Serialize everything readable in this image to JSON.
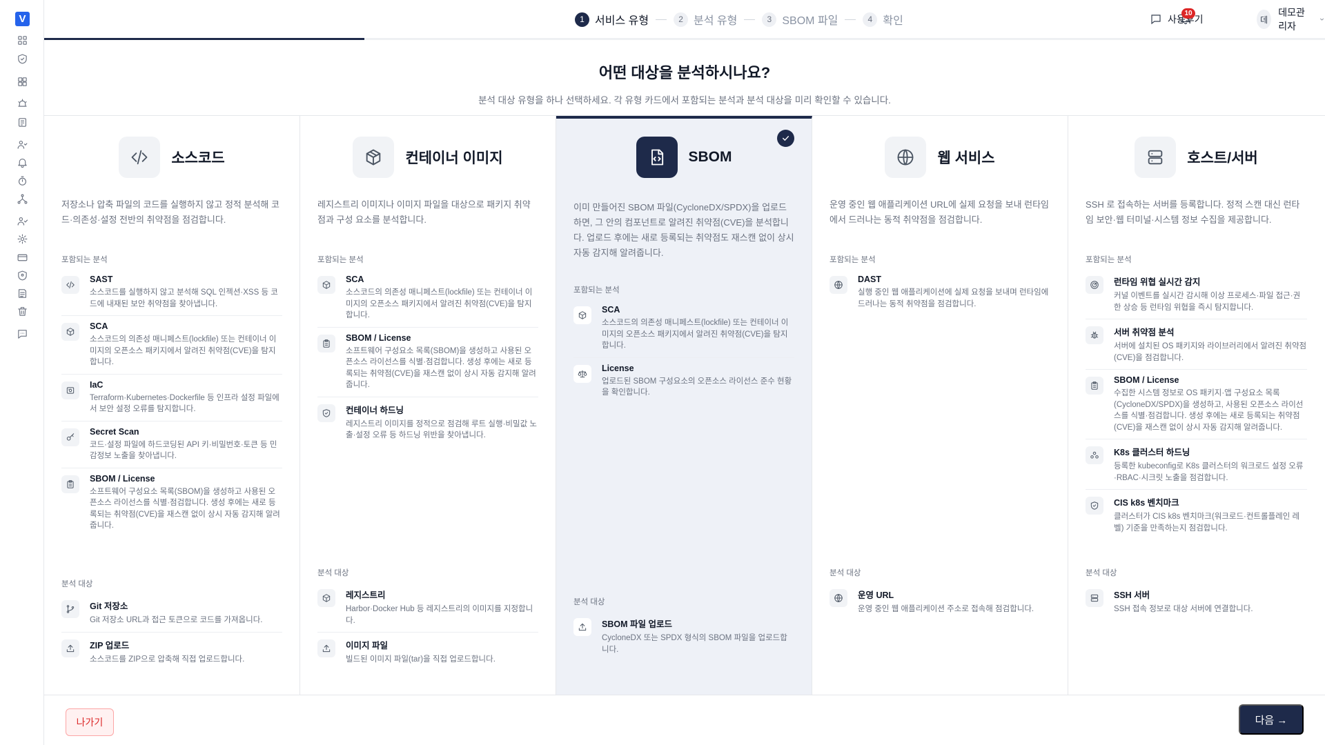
{
  "app": {
    "logo_letter": "V",
    "brand_color": "#2563eb",
    "accent": "#1e2a4a",
    "danger": "#dc2626"
  },
  "rail": [
    "dashboard-icon",
    "shield-check-icon",
    "grid-icon",
    "alarm-icon",
    "report-icon",
    "users-icon",
    "bell-icon",
    "timer-icon",
    "network-icon",
    "user-check-icon",
    "gear-icon",
    "card-icon",
    "shield-icon",
    "ledger-icon",
    "trash-icon",
    "chat-icon"
  ],
  "steps": [
    {
      "num": "1",
      "label": "서비스 유형",
      "active": true
    },
    {
      "num": "2",
      "label": "분석 유형",
      "active": false
    },
    {
      "num": "3",
      "label": "SBOM 파일",
      "active": false
    },
    {
      "num": "4",
      "label": "확인",
      "active": false
    }
  ],
  "progress_fraction": 0.25,
  "header": {
    "review_label": "사용후기",
    "notif_count": "10",
    "avatar_initial": "데",
    "user_name": "데모관리자"
  },
  "heading": {
    "title": "어떤 대상을 분석하시나요?",
    "subtitle": "분석 대상 유형을 하나 선택하세요. 각 유형 카드에서 포함되는 분석과 분석 대상을 미리 확인할 수 있습니다."
  },
  "labels": {
    "included": "포함되는 분석",
    "targets": "분석 대상"
  },
  "cards": [
    {
      "title": "소스코드",
      "icon": "code-icon",
      "selected": false,
      "desc": "저장소나 압축 파일의 코드를 실행하지 않고 정적 분석해 코드·의존성·설정 전반의 취약점을 점검합니다.",
      "analyses": [
        {
          "title": "SAST",
          "icon": "code-icon",
          "desc": "소스코드를 실행하지 않고 분석해 SQL 인젝션·XSS 등 코드에 내재된 보안 취약점을 찾아냅니다."
        },
        {
          "title": "SCA",
          "icon": "package-icon",
          "desc": "소스코드의 의존성 매니페스트(lockfile) 또는 컨테이너 이미지의 오픈소스 패키지에서 알려진 취약점(CVE)을 탐지합니다."
        },
        {
          "title": "IaC",
          "icon": "server-config-icon",
          "desc": "Terraform·Kubernetes·Dockerfile 등 인프라 설정 파일에서 보안 설정 오류를 탐지합니다."
        },
        {
          "title": "Secret Scan",
          "icon": "key-icon",
          "desc": "코드·설정 파일에 하드코딩된 API 키·비밀번호·토큰 등 민감정보 노출을 찾아냅니다."
        },
        {
          "title": "SBOM / License",
          "icon": "clipboard-icon",
          "desc": "소프트웨어 구성요소 목록(SBOM)을 생성하고 사용된 오픈소스 라이선스를 식별·점검합니다. 생성 후에는 새로 등록되는 취약점(CVE)을 재스캔 없이 상시 자동 감지해 알려줍니다."
        }
      ],
      "targets": [
        {
          "title": "Git 저장소",
          "icon": "git-branch-icon",
          "desc": "Git 저장소 URL과 접근 토큰으로 코드를 가져옵니다."
        },
        {
          "title": "ZIP 업로드",
          "icon": "upload-icon",
          "desc": "소스코드를 ZIP으로 압축해 직접 업로드합니다."
        }
      ]
    },
    {
      "title": "컨테이너 이미지",
      "icon": "container-box-icon",
      "selected": false,
      "desc": "레지스트리 이미지나 이미지 파일을 대상으로 패키지 취약점과 구성 요소를 분석합니다.",
      "analyses": [
        {
          "title": "SCA",
          "icon": "package-icon",
          "desc": "소스코드의 의존성 매니페스트(lockfile) 또는 컨테이너 이미지의 오픈소스 패키지에서 알려진 취약점(CVE)을 탐지합니다."
        },
        {
          "title": "SBOM / License",
          "icon": "clipboard-icon",
          "desc": "소프트웨어 구성요소 목록(SBOM)을 생성하고 사용된 오픈소스 라이선스를 식별·점검합니다. 생성 후에는 새로 등록되는 취약점(CVE)을 재스캔 없이 상시 자동 감지해 알려줍니다."
        },
        {
          "title": "컨테이너 하드닝",
          "icon": "shield-check-icon",
          "desc": "레지스트리 이미지를 정적으로 점검해 루트 실행·비밀값 노출·설정 오류 등 하드닝 위반을 찾아냅니다."
        }
      ],
      "targets": [
        {
          "title": "레지스트리",
          "icon": "package-icon",
          "desc": "Harbor·Docker Hub 등 레지스트리의 이미지를 지정합니다."
        },
        {
          "title": "이미지 파일",
          "icon": "upload-icon",
          "desc": "빌드된 이미지 파일(tar)을 직접 업로드합니다."
        }
      ]
    },
    {
      "title": "SBOM",
      "icon": "file-code-icon",
      "selected": true,
      "desc": "이미 만들어진 SBOM 파일(CycloneDX/SPDX)을 업로드하면, 그 안의 컴포넌트로 알려진 취약점(CVE)을 분석합니다. 업로드 후에는 새로 등록되는 취약점도 재스캔 없이 상시 자동 감지해 알려줍니다.",
      "analyses": [
        {
          "title": "SCA",
          "icon": "package-icon",
          "desc": "소스코드의 의존성 매니페스트(lockfile) 또는 컨테이너 이미지의 오픈소스 패키지에서 알려진 취약점(CVE)을 탐지합니다."
        },
        {
          "title": "License",
          "icon": "scale-icon",
          "desc": "업로드된 SBOM 구성요소의 오픈소스 라이선스 준수 현황을 확인합니다."
        }
      ],
      "targets": [
        {
          "title": "SBOM 파일 업로드",
          "icon": "upload-icon",
          "desc": "CycloneDX 또는 SPDX 형식의 SBOM 파일을 업로드합니다."
        }
      ]
    },
    {
      "title": "웹 서비스",
      "icon": "globe-icon",
      "selected": false,
      "desc": "운영 중인 웹 애플리케이션 URL에 실제 요청을 보내 런타임에서 드러나는 동적 취약점을 점검합니다.",
      "analyses": [
        {
          "title": "DAST",
          "icon": "globe-icon",
          "desc": "실행 중인 웹 애플리케이션에 실제 요청을 보내며 런타임에 드러나는 동적 취약점을 점검합니다."
        }
      ],
      "targets": [
        {
          "title": "운영 URL",
          "icon": "globe-icon",
          "desc": "운영 중인 웹 애플리케이션 주소로 접속해 점검합니다."
        }
      ]
    },
    {
      "title": "호스트/서버",
      "icon": "server-icon",
      "selected": false,
      "desc": "SSH 로 접속하는 서버를 등록합니다. 정적 스캔 대신 런타임 보안·웹 터미널·시스템 정보 수집을 제공합니다.",
      "analyses": [
        {
          "title": "런타임 위협 실시간 감지",
          "icon": "radar-icon",
          "desc": "커널 이벤트를 실시간 감시해 이상 프로세스·파일 접근·권한 상승 등 런타임 위협을 즉시 탐지합니다."
        },
        {
          "title": "서버 취약점 분석",
          "icon": "bug-icon",
          "desc": "서버에 설치된 OS 패키지와 라이브러리에서 알려진 취약점(CVE)을 점검합니다."
        },
        {
          "title": "SBOM / License",
          "icon": "clipboard-icon",
          "desc": "수집한 시스템 정보로 OS 패키지·앱 구성요소 목록(CycloneDX/SPDX)을 생성하고, 사용된 오픈소스 라이선스를 식별·점검합니다. 생성 후에는 새로 등록되는 취약점(CVE)을 재스캔 없이 상시 자동 감지해 알려줍니다."
        },
        {
          "title": "K8s 클러스터 하드닝",
          "icon": "cluster-icon",
          "desc": "등록한 kubeconfig로 K8s 클러스터의 워크로드 설정 오류·RBAC·시크릿 노출을 점검합니다."
        },
        {
          "title": "CIS k8s 벤치마크",
          "icon": "shield-check-icon",
          "desc": "클러스터가 CIS k8s 벤치마크(워크로드·컨트롤플레인 레벨) 기준을 만족하는지 점검합니다."
        }
      ],
      "targets": [
        {
          "title": "SSH 서버",
          "icon": "server-icon",
          "desc": "SSH 접속 정보로 대상 서버에 연결합니다."
        }
      ]
    }
  ],
  "footer": {
    "exit_label": "나가기",
    "next_label": "다음 →"
  }
}
